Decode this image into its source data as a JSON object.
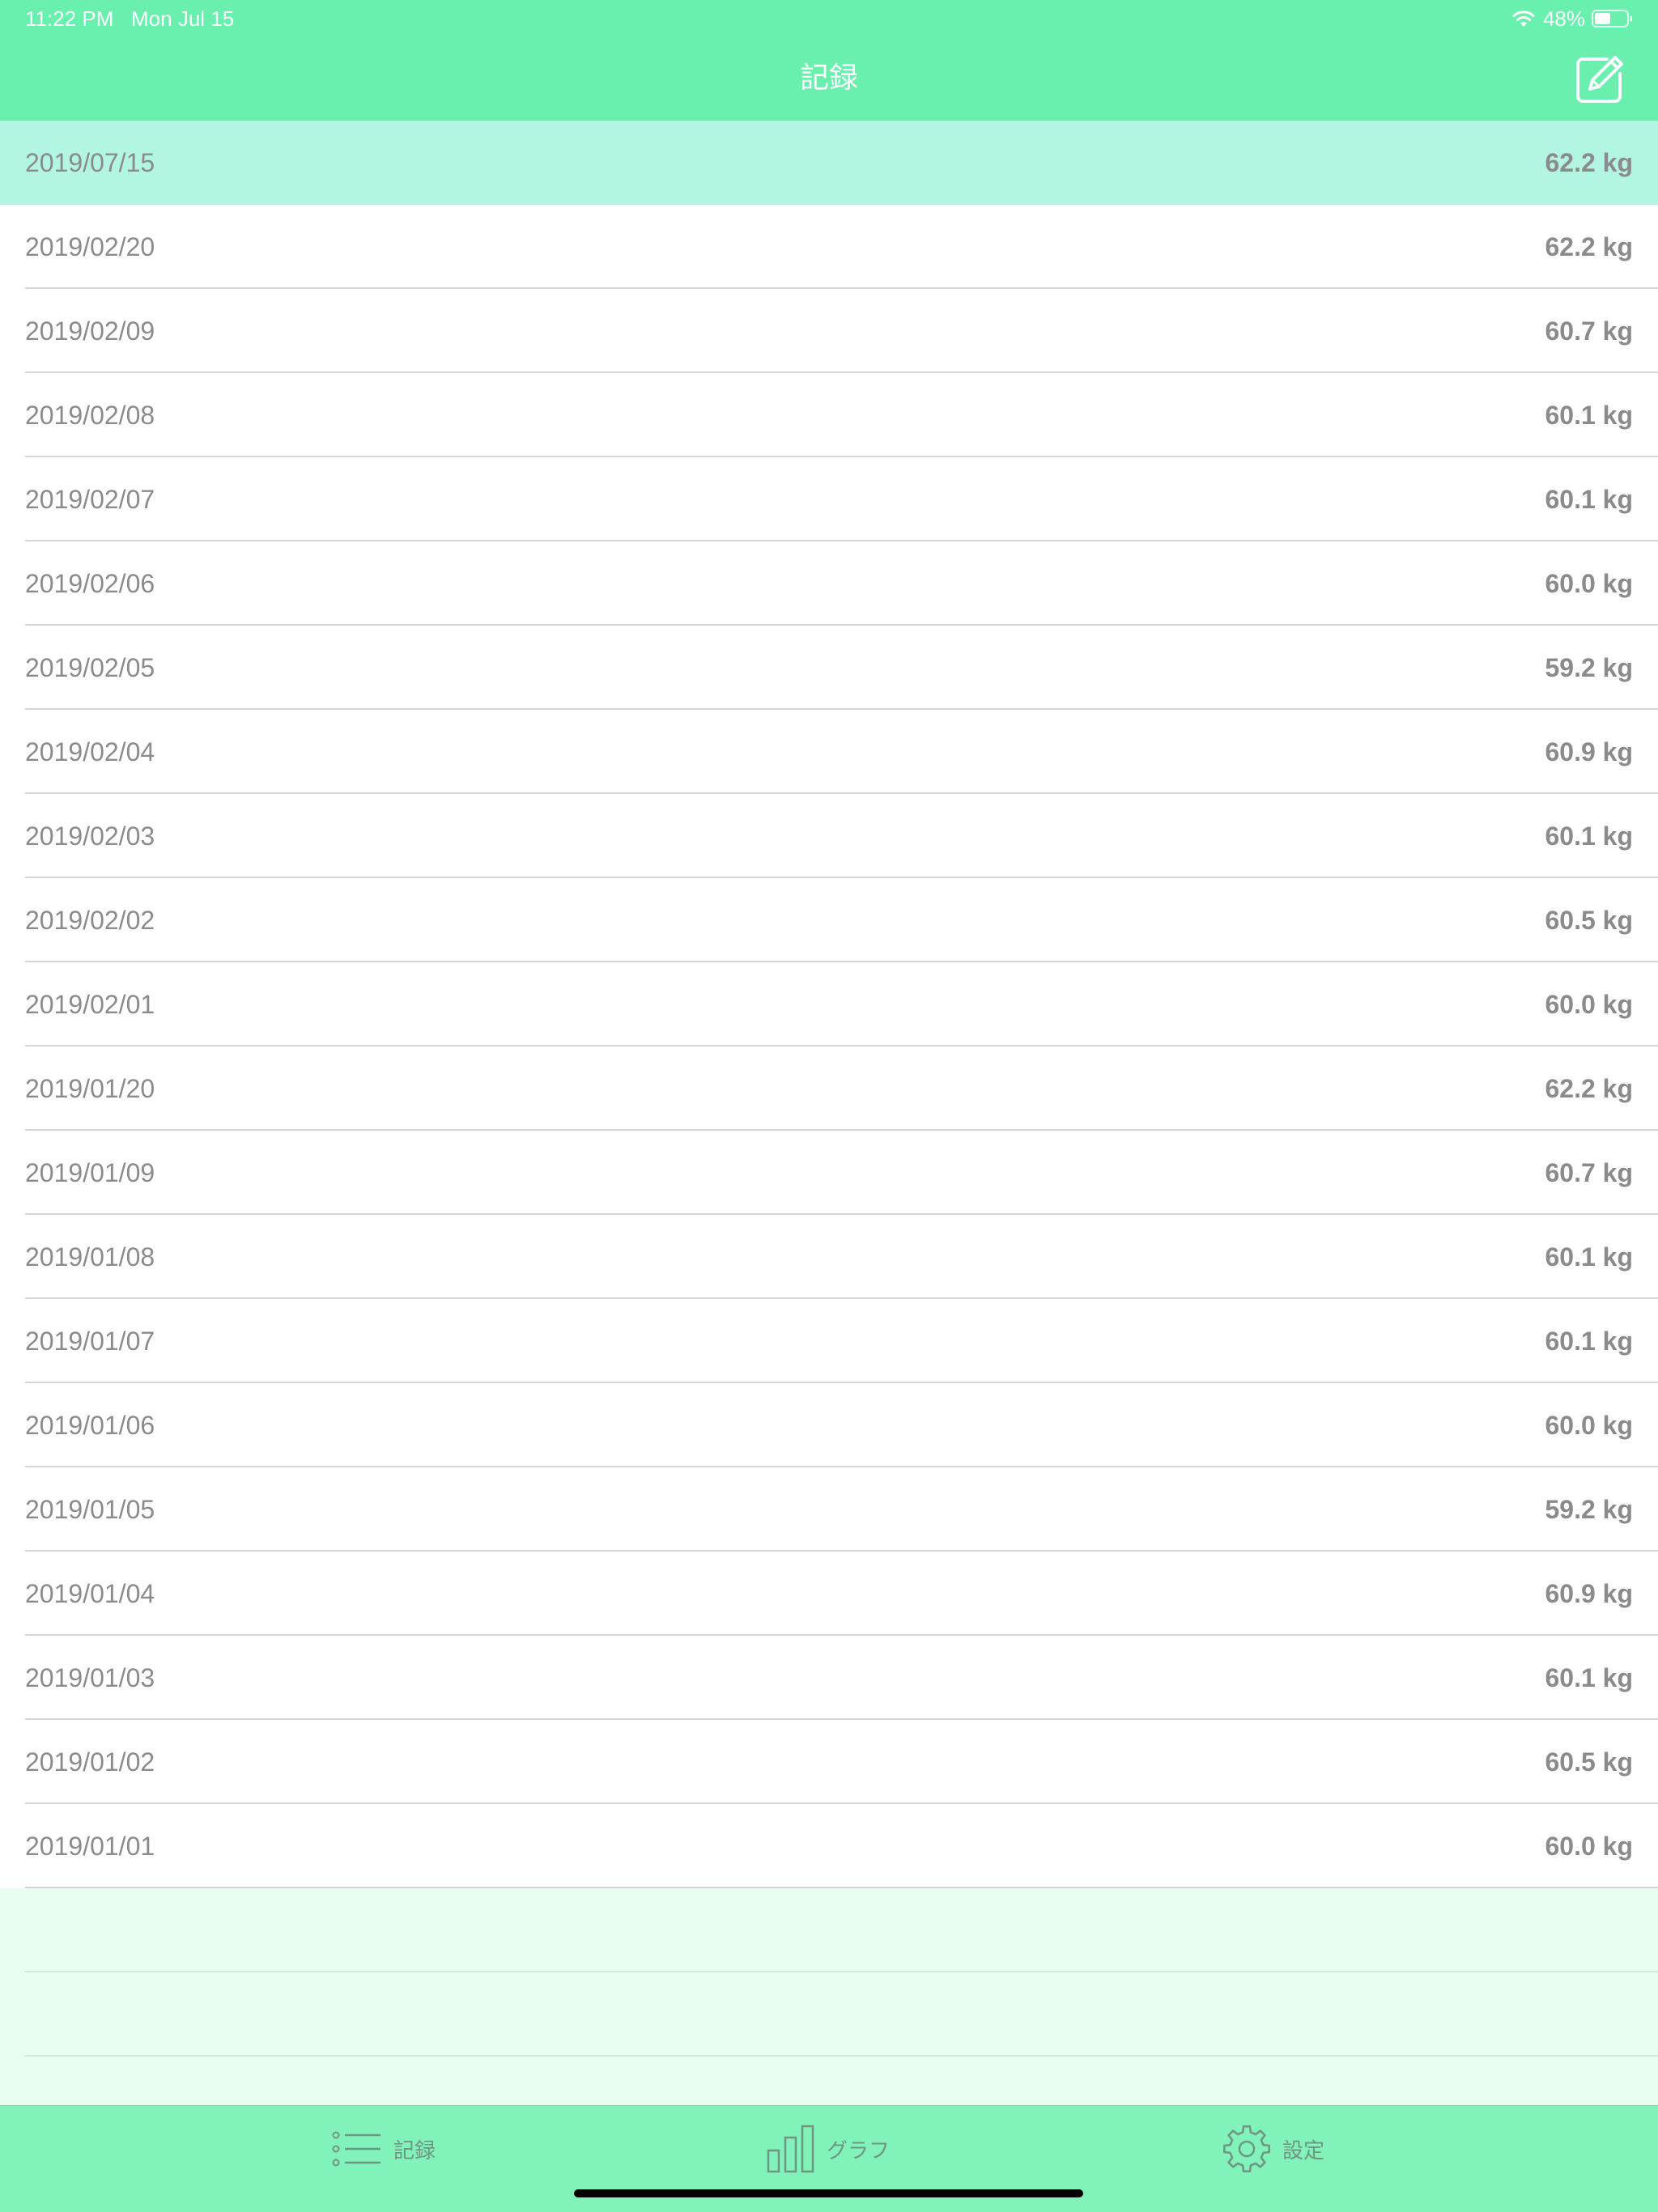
{
  "status_bar": {
    "time": "11:22 PM   Mon Jul 15",
    "battery": "48%"
  },
  "nav": {
    "title": "記録"
  },
  "records": [
    {
      "date": "2019/07/15",
      "weight": "62.2 kg",
      "selected": true
    },
    {
      "date": "2019/02/20",
      "weight": "62.2 kg"
    },
    {
      "date": "2019/02/09",
      "weight": "60.7 kg"
    },
    {
      "date": "2019/02/08",
      "weight": "60.1 kg"
    },
    {
      "date": "2019/02/07",
      "weight": "60.1 kg"
    },
    {
      "date": "2019/02/06",
      "weight": "60.0 kg"
    },
    {
      "date": "2019/02/05",
      "weight": "59.2 kg"
    },
    {
      "date": "2019/02/04",
      "weight": "60.9 kg"
    },
    {
      "date": "2019/02/03",
      "weight": "60.1 kg"
    },
    {
      "date": "2019/02/02",
      "weight": "60.5 kg"
    },
    {
      "date": "2019/02/01",
      "weight": "60.0 kg"
    },
    {
      "date": "2019/01/20",
      "weight": "62.2 kg"
    },
    {
      "date": "2019/01/09",
      "weight": "60.7 kg"
    },
    {
      "date": "2019/01/08",
      "weight": "60.1 kg"
    },
    {
      "date": "2019/01/07",
      "weight": "60.1 kg"
    },
    {
      "date": "2019/01/06",
      "weight": "60.0 kg"
    },
    {
      "date": "2019/01/05",
      "weight": "59.2 kg"
    },
    {
      "date": "2019/01/04",
      "weight": "60.9 kg"
    },
    {
      "date": "2019/01/03",
      "weight": "60.1 kg"
    },
    {
      "date": "2019/01/02",
      "weight": "60.5 kg"
    },
    {
      "date": "2019/01/01",
      "weight": "60.0 kg"
    }
  ],
  "tabbar": {
    "tabs": [
      {
        "label": "記録",
        "icon": "list-icon"
      },
      {
        "label": "グラフ",
        "icon": "bar-chart-icon"
      },
      {
        "label": "設定",
        "icon": "gear-icon"
      }
    ]
  },
  "colors": {
    "header": "#69f0ae",
    "selected_row": "#b2f5e2",
    "tabbar": "#80f2ba",
    "empty_background": "#e8fcf0",
    "text": "#8b8b8b"
  }
}
